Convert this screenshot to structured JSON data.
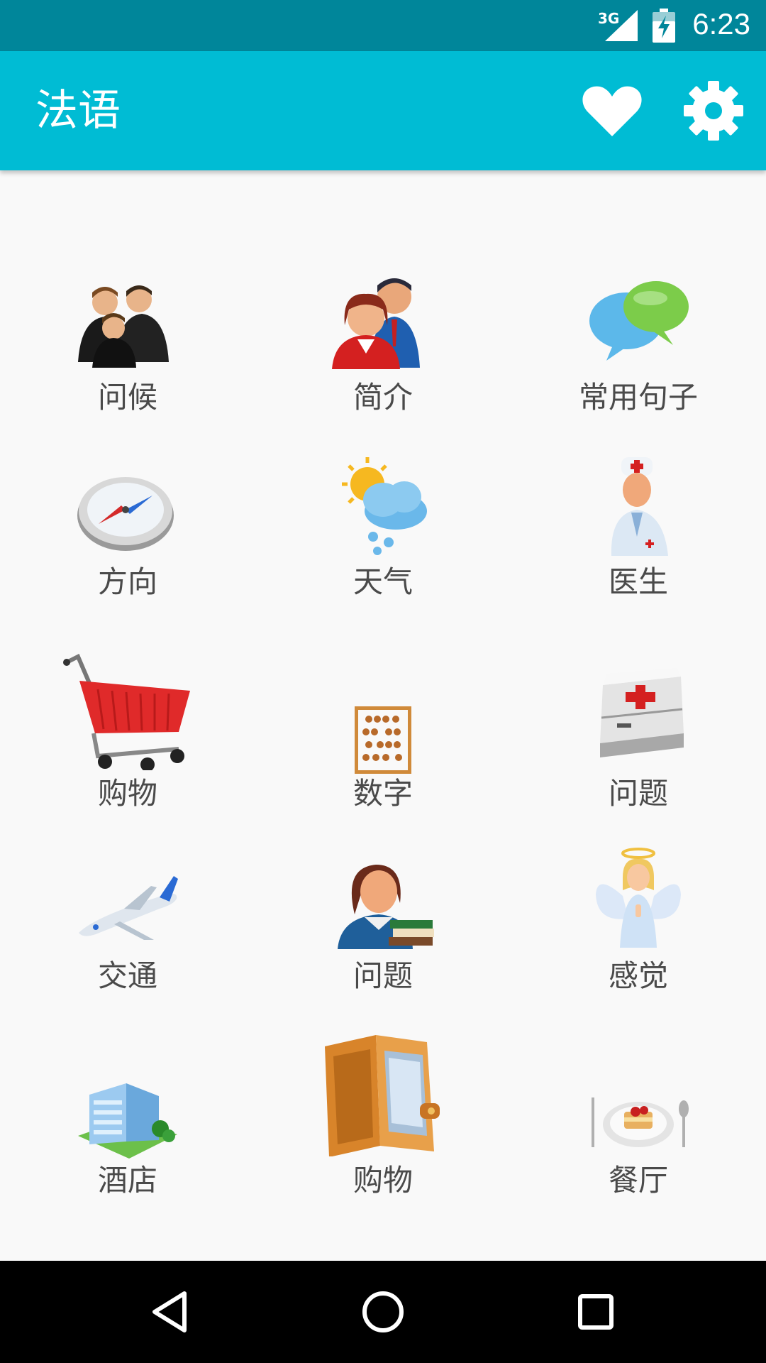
{
  "status_bar": {
    "network": "3G",
    "time": "6:23",
    "icons": [
      "signal-icon",
      "battery-charging-icon"
    ]
  },
  "app_bar": {
    "title": "法语",
    "actions": [
      {
        "icon": "heart-icon",
        "name": "favorites"
      },
      {
        "icon": "gear-icon",
        "name": "settings"
      }
    ]
  },
  "categories": [
    {
      "label": "问候",
      "icon": "greeting-people-icon"
    },
    {
      "label": "简介",
      "icon": "introduction-people-icon"
    },
    {
      "label": "常用句子",
      "icon": "speech-bubbles-icon"
    },
    {
      "label": "方向",
      "icon": "compass-icon"
    },
    {
      "label": "天气",
      "icon": "weather-icon"
    },
    {
      "label": "医生",
      "icon": "doctor-icon"
    },
    {
      "label": "购物",
      "icon": "shopping-cart-icon"
    },
    {
      "label": "数字",
      "icon": "abacus-icon"
    },
    {
      "label": "问题",
      "icon": "first-aid-kit-icon"
    },
    {
      "label": "交通",
      "icon": "airplane-icon"
    },
    {
      "label": "问题",
      "icon": "teacher-books-icon"
    },
    {
      "label": "感觉",
      "icon": "angel-icon"
    },
    {
      "label": "酒店",
      "icon": "hotel-building-icon"
    },
    {
      "label": "购物",
      "icon": "wallet-icon"
    },
    {
      "label": "餐厅",
      "icon": "restaurant-plate-icon"
    }
  ],
  "colors": {
    "status_bar": "#00869a",
    "app_bar": "#00bcd4",
    "background": "#f9f9f9",
    "label_text": "#4a4a4a",
    "nav_bar": "#000000"
  },
  "nav_bar": [
    "back-icon",
    "home-icon",
    "recents-icon"
  ]
}
